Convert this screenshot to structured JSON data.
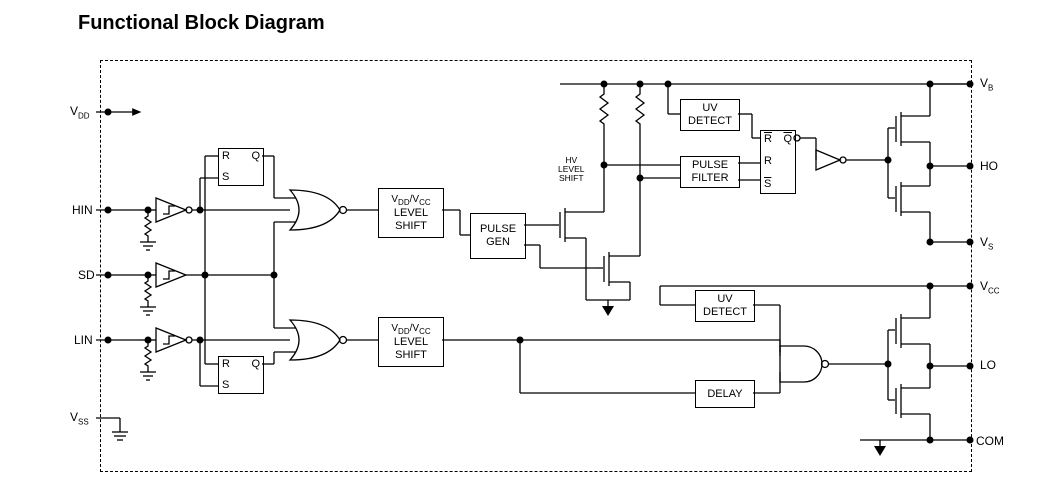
{
  "title": "Functional Block Diagram",
  "blocks": {
    "sr_top": {
      "R": "R",
      "S": "S",
      "Q": "Q"
    },
    "sr_bot": {
      "R": "R",
      "S": "S",
      "Q": "Q"
    },
    "ls_top": "LEVEL\nSHIFT",
    "ls_top_hdr": "V_DD/V_CC",
    "ls_bot": "LEVEL\nSHIFT",
    "ls_bot_hdr": "V_DD/V_CC",
    "pulsegen": "PULSE\nGEN",
    "hvls": "HV\nLEVEL\nSHIFT",
    "uv_top": "UV\nDETECT",
    "pfilter": "PULSE\nFILTER",
    "sr_hv": {
      "R": "R",
      "Rbar": "R",
      "S": "S",
      "Q": "Q"
    },
    "uv_bot": "UV\nDETECT",
    "delay": "DELAY"
  },
  "pins": {
    "VDD": "V_DD",
    "HIN": "HIN",
    "SD": "SD",
    "LIN": "LIN",
    "VSS": "V_SS",
    "VB": "V_B",
    "HO": "HO",
    "VS": "V_S",
    "VCC": "V_CC",
    "LO": "LO",
    "COM": "COM"
  },
  "chart_data": {
    "type": "block-diagram",
    "title": "Functional Block Diagram",
    "inputs": [
      "VDD",
      "HIN",
      "SD",
      "LIN",
      "VSS"
    ],
    "outputs": [
      "VB",
      "HO",
      "VS",
      "VCC",
      "LO",
      "COM"
    ],
    "nodes": [
      {
        "id": "schmitt_hin",
        "type": "schmitt-inverter"
      },
      {
        "id": "schmitt_sd",
        "type": "schmitt-inverter",
        "note": "non-inverting Schmitt"
      },
      {
        "id": "schmitt_lin",
        "type": "schmitt-inverter"
      },
      {
        "id": "sr_top",
        "type": "SR-latch",
        "ports": [
          "R",
          "S",
          "Q"
        ]
      },
      {
        "id": "sr_bot",
        "type": "SR-latch",
        "ports": [
          "R",
          "S",
          "Q"
        ]
      },
      {
        "id": "nor_top",
        "type": "NOR2"
      },
      {
        "id": "nor_bot",
        "type": "NOR2"
      },
      {
        "id": "ls_top",
        "type": "block",
        "label": "VDD/VCC LEVEL SHIFT"
      },
      {
        "id": "ls_bot",
        "type": "block",
        "label": "VDD/VCC LEVEL SHIFT"
      },
      {
        "id": "pulsegen",
        "type": "block",
        "label": "PULSE GEN"
      },
      {
        "id": "hv_mos_p",
        "type": "MOSFET"
      },
      {
        "id": "hv_mos_n",
        "type": "MOSFET"
      },
      {
        "id": "hv_res_p",
        "type": "resistor"
      },
      {
        "id": "hv_res_n",
        "type": "resistor"
      },
      {
        "id": "hvls_label",
        "type": "label",
        "label": "HV LEVEL SHIFT"
      },
      {
        "id": "uv_top",
        "type": "block",
        "label": "UV DETECT"
      },
      {
        "id": "pfilter",
        "type": "block",
        "label": "PULSE FILTER"
      },
      {
        "id": "sr_hv",
        "type": "SR-latch",
        "ports": [
          "R",
          "R̅",
          "S",
          "Q̅"
        ]
      },
      {
        "id": "inv_ho",
        "type": "inverter"
      },
      {
        "id": "driver_ho_p",
        "type": "MOSFET"
      },
      {
        "id": "driver_ho_n",
        "type": "MOSFET"
      },
      {
        "id": "uv_bot",
        "type": "block",
        "label": "UV DETECT"
      },
      {
        "id": "delay",
        "type": "block",
        "label": "DELAY"
      },
      {
        "id": "nand_lo",
        "type": "NAND2"
      },
      {
        "id": "driver_lo_p",
        "type": "MOSFET"
      },
      {
        "id": "driver_lo_n",
        "type": "MOSFET"
      }
    ],
    "edges": [
      [
        "HIN",
        "schmitt_hin"
      ],
      [
        "schmitt_hin",
        "sr_top.S"
      ],
      [
        "schmitt_hin",
        "nor_top"
      ],
      [
        "SD",
        "schmitt_sd"
      ],
      [
        "schmitt_sd",
        "sr_top.R"
      ],
      [
        "schmitt_sd",
        "sr_bot.R"
      ],
      [
        "schmitt_sd",
        "nor_top"
      ],
      [
        "schmitt_sd",
        "nor_bot"
      ],
      [
        "LIN",
        "schmitt_lin"
      ],
      [
        "schmitt_lin",
        "sr_bot.S"
      ],
      [
        "schmitt_lin",
        "nor_bot"
      ],
      [
        "sr_top.Q",
        "nor_top"
      ],
      [
        "sr_bot.Q",
        "nor_bot"
      ],
      [
        "nor_top",
        "ls_top"
      ],
      [
        "ls_top",
        "pulsegen"
      ],
      [
        "pulsegen",
        "hv_mos_p.gate"
      ],
      [
        "pulsegen",
        "hv_mos_n.gate"
      ],
      [
        "hv_mos_p.drain",
        "hv_res_p"
      ],
      [
        "hv_mos_n.drain",
        "hv_res_n"
      ],
      [
        "hv_res_p",
        "VB"
      ],
      [
        "hv_res_n",
        "VB"
      ],
      [
        "hv_mos_p.drain",
        "pfilter"
      ],
      [
        "hv_mos_n.drain",
        "pfilter"
      ],
      [
        "VB",
        "uv_top"
      ],
      [
        "uv_top",
        "sr_hv.R̅"
      ],
      [
        "pfilter",
        "sr_hv.R"
      ],
      [
        "pfilter",
        "sr_hv.S"
      ],
      [
        "sr_hv.Q̅",
        "inv_ho"
      ],
      [
        "inv_ho",
        "driver_ho_p.gate"
      ],
      [
        "inv_ho",
        "driver_ho_n.gate"
      ],
      [
        "driver_ho_p.drain",
        "VB"
      ],
      [
        "driver_ho_n.source",
        "VS"
      ],
      [
        "driver_ho_p/ n common",
        "HO"
      ],
      [
        "nor_bot",
        "ls_bot"
      ],
      [
        "ls_bot",
        "delay"
      ],
      [
        "ls_bot",
        "nand_lo"
      ],
      [
        "VCC",
        "uv_bot"
      ],
      [
        "uv_bot",
        "nand_lo"
      ],
      [
        "delay",
        "nand_lo"
      ],
      [
        "nand_lo",
        "driver_lo_p.gate"
      ],
      [
        "nand_lo",
        "driver_lo_n.gate"
      ],
      [
        "driver_lo_p.drain",
        "VCC"
      ],
      [
        "driver_lo_n.source",
        "COM"
      ],
      [
        "driver_lo common",
        "LO"
      ]
    ]
  }
}
